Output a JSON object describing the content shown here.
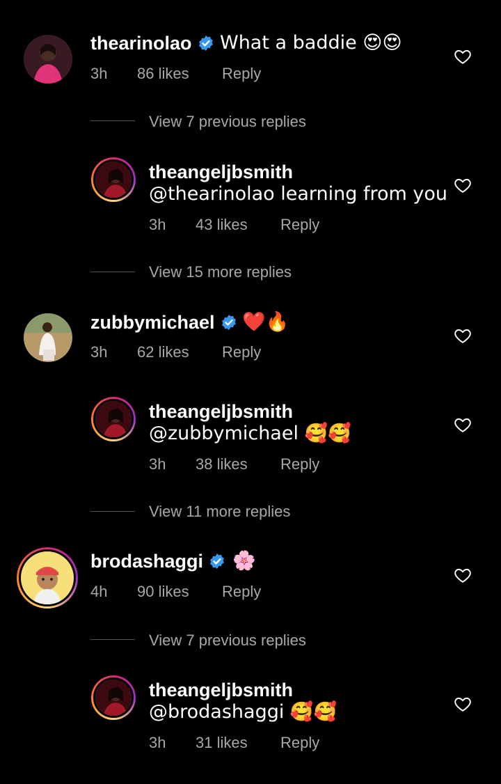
{
  "colors": {
    "background": "#000000",
    "text": "#ffffff",
    "muted": "#a8a8a8",
    "verified": "#3897f0"
  },
  "comments": [
    {
      "user": "thearinolao",
      "verified": true,
      "text": "What a baddie 😍😍",
      "time": "3h",
      "likes": "86 likes",
      "reply": "Reply"
    },
    {
      "user": "zubbymichael",
      "verified": true,
      "text": "❤️🔥",
      "time": "3h",
      "likes": "62 likes",
      "reply": "Reply"
    },
    {
      "user": "brodashaggi",
      "verified": true,
      "text": "🌸",
      "time": "4h",
      "likes": "90 likes",
      "reply": "Reply"
    }
  ],
  "replies": [
    {
      "user": "theangeljbsmith",
      "text": "@thearinolao learning from you",
      "time": "3h",
      "likes": "43 likes",
      "reply": "Reply"
    },
    {
      "user": "theangeljbsmith",
      "text": "@zubbymichael 🥰🥰",
      "time": "3h",
      "likes": "38 likes",
      "reply": "Reply"
    },
    {
      "user": "theangeljbsmith",
      "text": "@brodashaggi 🥰🥰",
      "time": "3h",
      "likes": "31 likes",
      "reply": "Reply"
    }
  ],
  "view_links": [
    "View 7 previous replies",
    "View 15 more replies",
    "View 11 more replies",
    "View 7 previous replies"
  ],
  "icons": {
    "verified": "verified-badge-icon",
    "like": "heart-outline-icon"
  }
}
